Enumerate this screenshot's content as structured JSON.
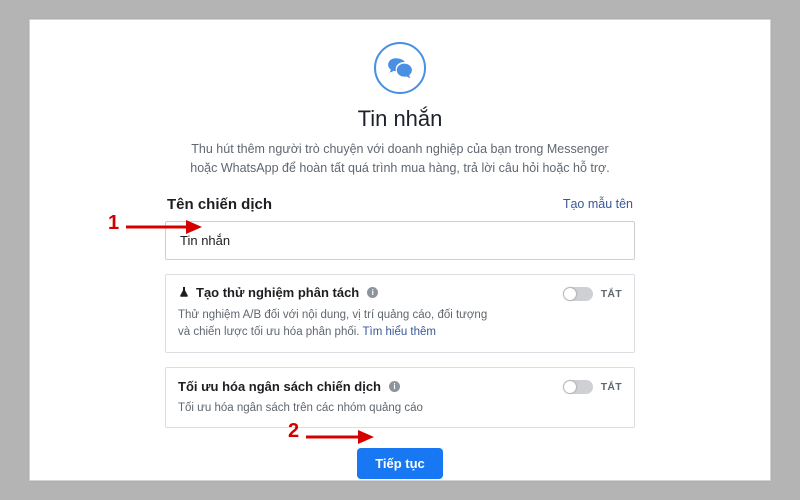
{
  "header": {
    "title": "Tin nhắn",
    "subtitle": "Thu hút thêm người trò chuyện với doanh nghiệp của bạn trong Messenger hoặc WhatsApp để hoàn tất quá trình mua hàng, trả lời câu hỏi hoặc hỗ trợ."
  },
  "campaign": {
    "label": "Tên chiến dịch",
    "name_template_link": "Tạo mẫu tên",
    "name_value": "Tin nhắn"
  },
  "split_test": {
    "title": "Tạo thử nghiệm phân tách",
    "desc": "Thử nghiệm A/B đối với nội dung, vị trí quảng cáo, đối tượng và chiến lược tối ưu hóa phân phối.",
    "learn_more": "Tìm hiểu thêm",
    "state": "TẮT"
  },
  "budget_opt": {
    "title": "Tối ưu hóa ngân sách chiến dịch",
    "desc": "Tối ưu hóa ngân sách trên các nhóm quảng cáo",
    "state": "TẮT"
  },
  "cta": {
    "label": "Tiếp tục"
  },
  "annotations": {
    "n1": "1",
    "n2": "2"
  }
}
